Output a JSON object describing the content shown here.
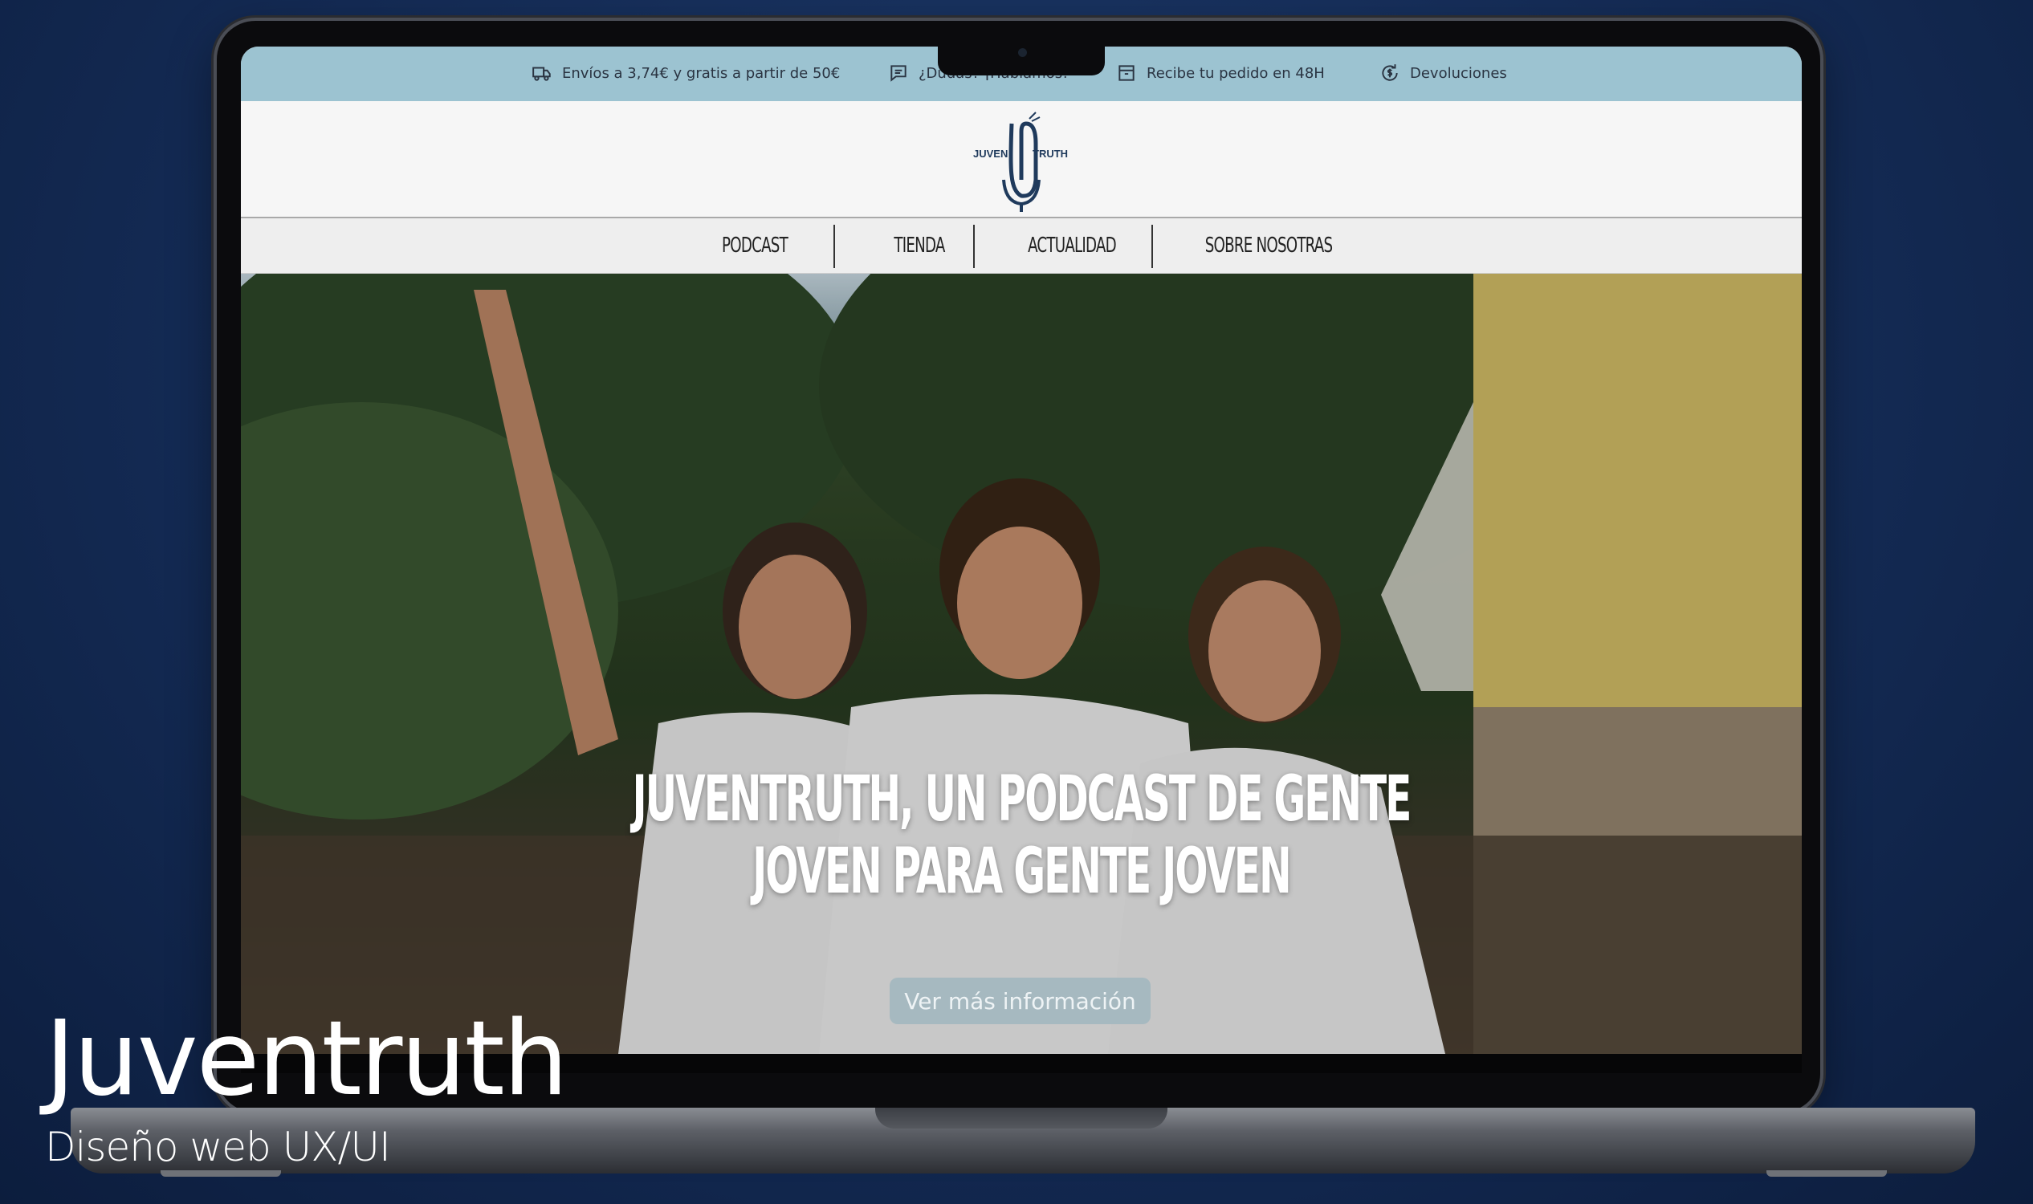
{
  "topbar": {
    "items": [
      {
        "icon": "truck-icon",
        "label": "Envíos a 3,74€ y gratis a partir de 50€"
      },
      {
        "icon": "chat-icon",
        "label": "¿Dudas? ¡Hablamos!"
      },
      {
        "icon": "box-icon",
        "label": "Recibe tu pedido en 48H"
      },
      {
        "icon": "return-money-icon",
        "label": "Devoluciones"
      }
    ],
    "background": "#9cc3d1"
  },
  "header": {
    "logo_left": "JUVEN",
    "logo_right": "TRUTH",
    "logo_color": "#1f3a5c"
  },
  "nav": {
    "items": [
      "PODCAST",
      "TIENDA",
      "ACTUALIDAD",
      "SOBRE NOSOTRAS"
    ]
  },
  "hero": {
    "title_line1": "JUVENTRUTH, UN PODCAST DE GENTE",
    "title_line2": "JOVEN PARA GENTE JOVEN",
    "button": "Ver más información"
  },
  "caption": {
    "title": "Juventruth",
    "subtitle": "Diseño web UX/UI"
  }
}
